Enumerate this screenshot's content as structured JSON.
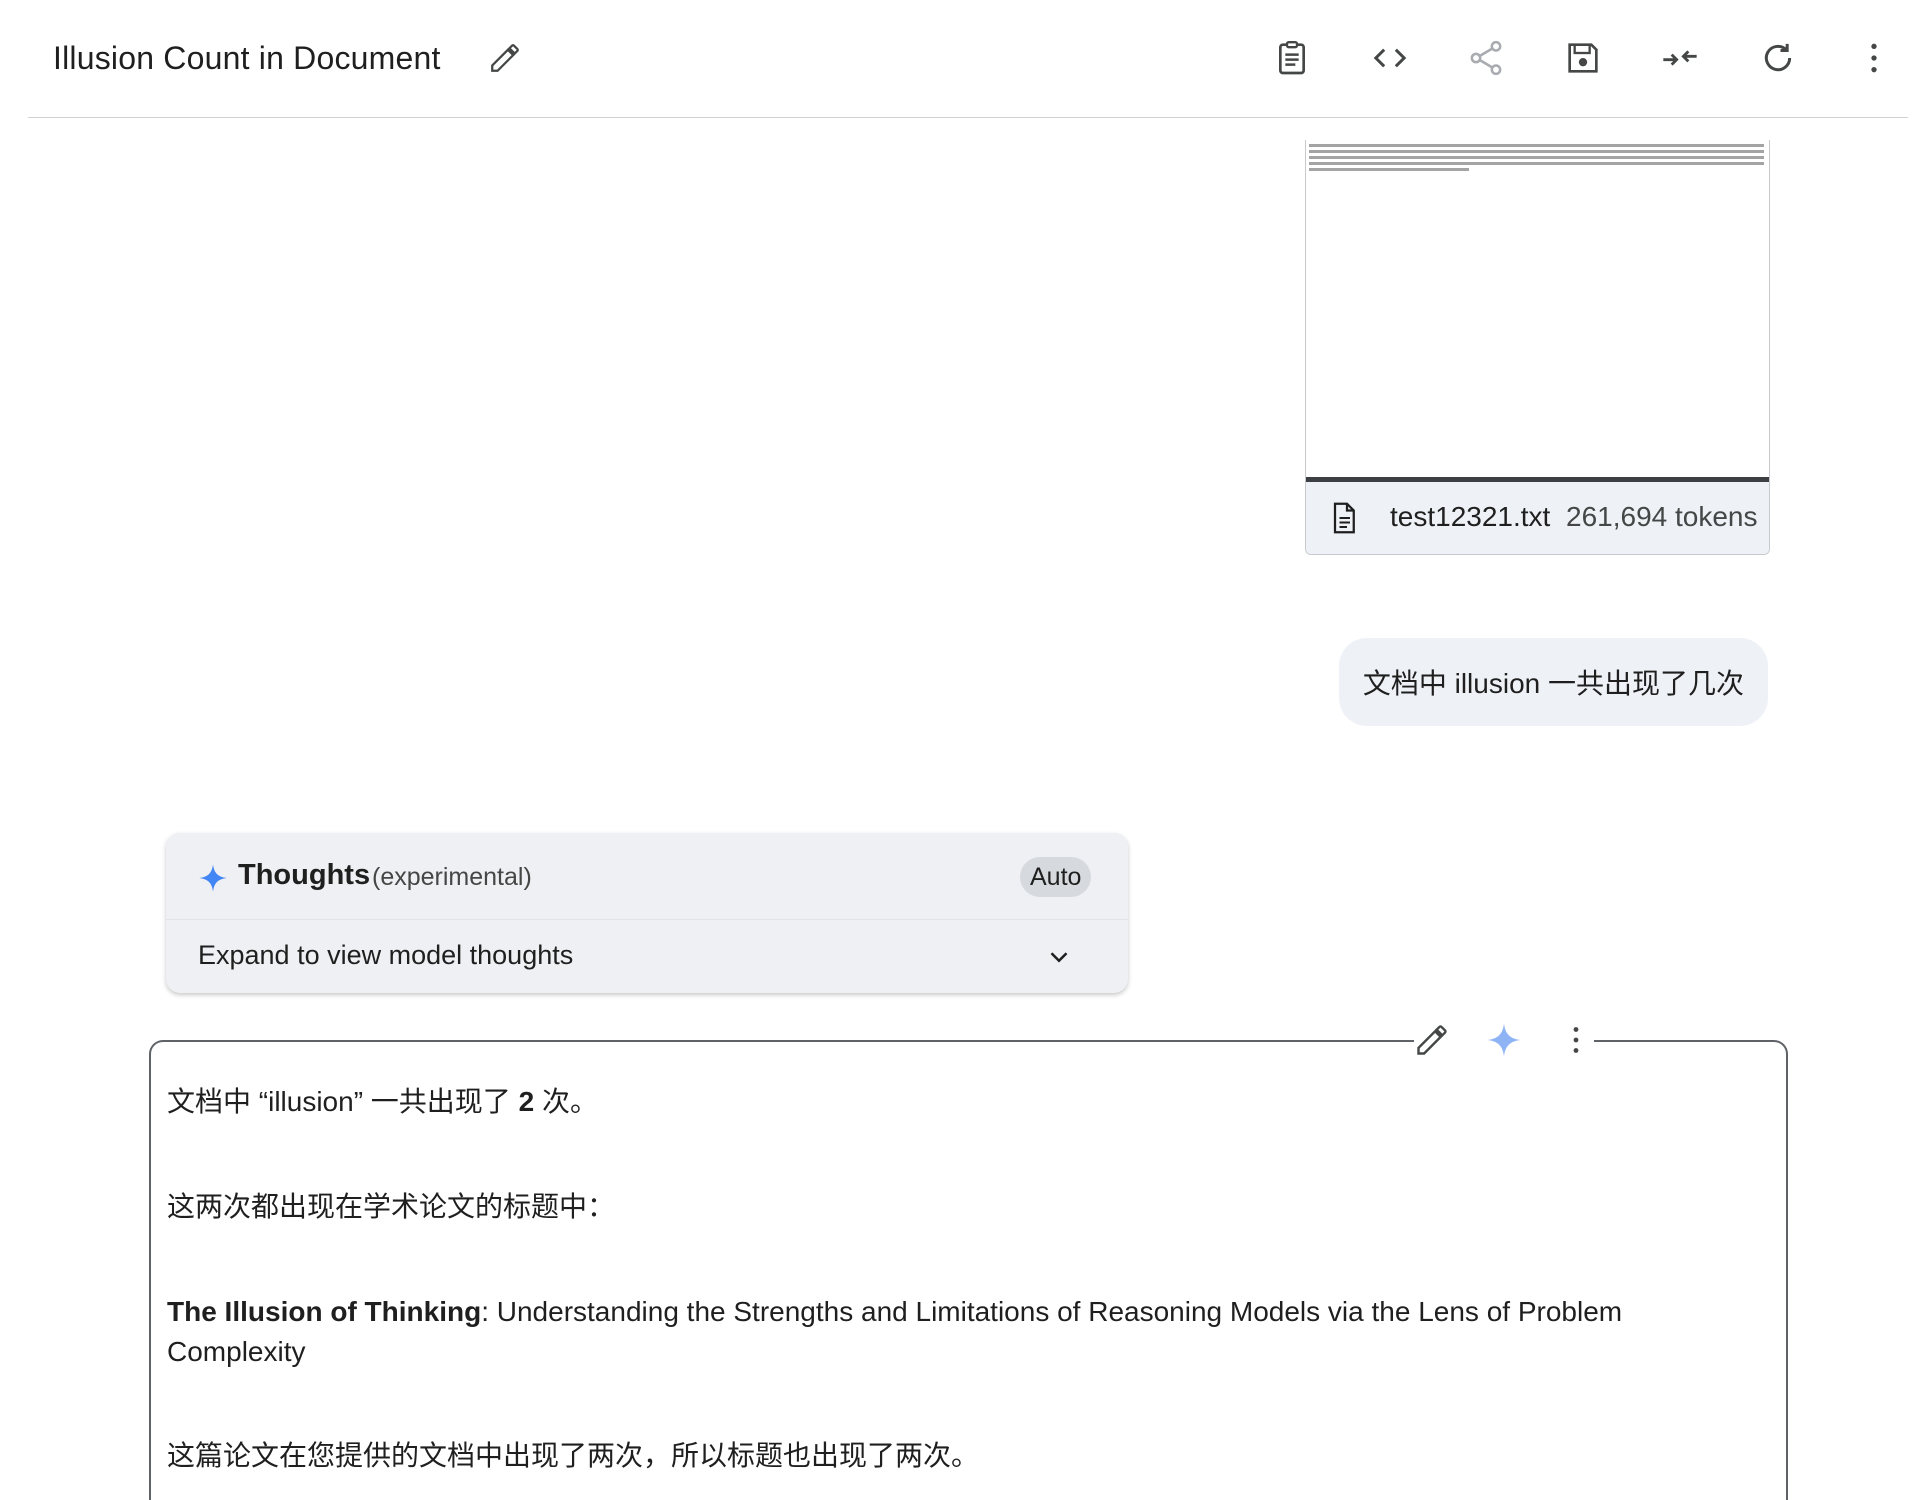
{
  "header": {
    "title": "Illusion Count in Document",
    "icons": [
      "edit-icon",
      "clipboard-icon",
      "code-icon",
      "share-icon",
      "save-icon",
      "collapse-icon",
      "refresh-icon",
      "more-vert-icon"
    ]
  },
  "file": {
    "name": "test12321.txt",
    "tokens": "261,694 tokens"
  },
  "user_message": "文档中 illusion 一共出现了几次",
  "thoughts": {
    "title": "Thoughts",
    "subtitle": "(experimental)",
    "mode": "Auto",
    "expand_label": "Expand to view model thoughts"
  },
  "response": {
    "line1_pre": "文档中 “illusion” 一共出现了 ",
    "line1_bold": "2",
    "line1_post": " 次。",
    "line2": "这两次都出现在学术论文的标题中：",
    "line3_bold": "The Illusion of Thinking",
    "line3_rest": ": Understanding the Strengths and Limitations of Reasoning Models via the Lens of Problem",
    "line3_cont": "Complexity",
    "line4": "这篇论文在您提供的文档中出现了两次，所以标题也出现了两次。"
  },
  "colors": {
    "accent_spark": "#4285f4",
    "bubble_bg": "#eef1f6",
    "thoughts_bg": "#eef0f3"
  }
}
